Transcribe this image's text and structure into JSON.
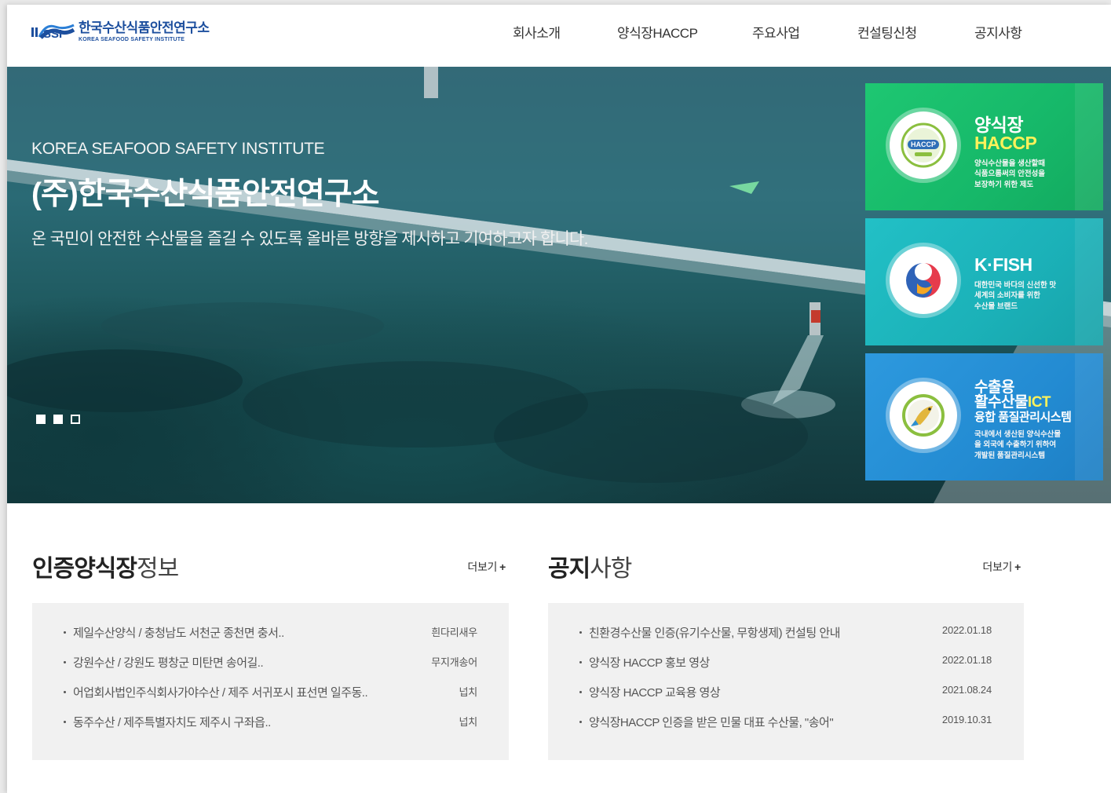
{
  "header": {
    "logo_ko": "한국수산식품안전연구소",
    "logo_en": "KOREA SEAFOOD SAFETY INSTITUTE",
    "nav": [
      "회사소개",
      "양식장HACCP",
      "주요사업",
      "컨설팅신청",
      "공지사항"
    ]
  },
  "hero": {
    "en": "KOREA SEAFOOD SAFETY INSTITUTE",
    "title": "(주)한국수산식품안전연구소",
    "subtitle": "온 국민이 안전한 수산물을 즐길 수 있도록 올바른 방향을 제시하고 기여하고자 합니다.",
    "slides": {
      "count": 3,
      "active_index": 2
    }
  },
  "cards": {
    "haccp": {
      "badge_text": "HACCP",
      "title_line1": "양식장",
      "title_line2": "HACCP",
      "desc": [
        "양식수산물을 생산할때",
        "식품으롬써의 안전성을",
        "보장하기 위한 제도"
      ]
    },
    "kfish": {
      "title": "K·FISH",
      "desc": [
        "대한민국 바다의 신선한 맛",
        "세계의 소비자를 위한",
        "수산물 브랜드"
      ]
    },
    "ict": {
      "title_line1": "수출용",
      "title_line2a": "활수산물",
      "title_line2b": "ICT",
      "title_line3": "융합 품질관리시스템",
      "desc": [
        "국내에서 생산된 양식수산물",
        "을 외국에 수출하기 위하여",
        "개발된 품질관리시스템"
      ]
    }
  },
  "farms": {
    "title_strong": "인증양식장",
    "title_light": "정보",
    "more": "더보기",
    "rows": [
      {
        "text": "제일수산양식 / 충청남도 서천군 종천면 충서..",
        "meta": "흰다리새우"
      },
      {
        "text": "강원수산 / 강원도 평창군 미탄면 송어길..",
        "meta": "무지개송어"
      },
      {
        "text": "어업회사법인주식회사가야수산 / 제주 서귀포시 표선면 일주동..",
        "meta": "넙치"
      },
      {
        "text": "동주수산 / 제주특별자치도 제주시 구좌읍..",
        "meta": "넙치"
      }
    ]
  },
  "notices": {
    "title_strong": "공지",
    "title_light": "사항",
    "more": "더보기",
    "rows": [
      {
        "text": "친환경수산물 인증(유기수산물, 무항생제) 컨설팅 안내",
        "meta": "2022.01.18"
      },
      {
        "text": "양식장 HACCP 홍보 영상",
        "meta": "2022.01.18"
      },
      {
        "text": "양식장 HACCP 교육용 영상",
        "meta": "2021.08.24"
      },
      {
        "text": "양식장HACCP 인증을 받은 민물 대표 수산물, \"송어\"",
        "meta": "2019.10.31"
      }
    ]
  },
  "colors": {
    "brand_blue": "#1d4f9e",
    "haccp_green": "#16b869",
    "kfish_teal": "#1bb1b8",
    "ict_blue": "#238bd2",
    "accent_yellow": "#fff25a"
  }
}
